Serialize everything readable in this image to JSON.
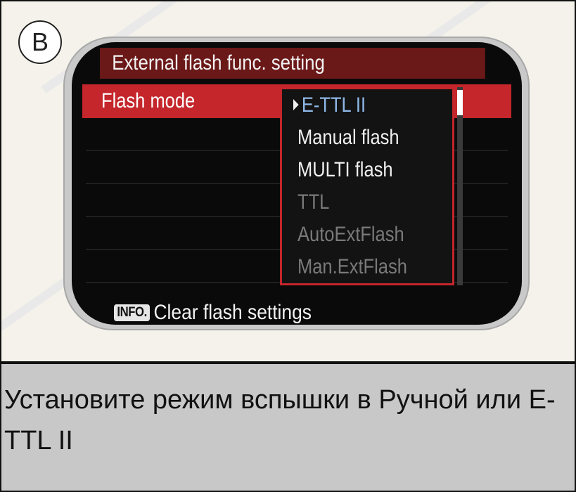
{
  "panel_label": "B",
  "menu": {
    "title": "External flash func. setting",
    "row_label": "Flash mode",
    "options": [
      {
        "label": "E-TTL II",
        "state": "selected"
      },
      {
        "label": "Manual flash",
        "state": "bright"
      },
      {
        "label": "MULTI  flash",
        "state": "bright"
      },
      {
        "label": "TTL",
        "state": "dim"
      },
      {
        "label": "AutoExtFlash",
        "state": "dim"
      },
      {
        "label": "Man.ExtFlash",
        "state": "dim"
      }
    ],
    "scroll_fraction": 0.13
  },
  "footer": {
    "info_badge": "INFO.",
    "info_text": "Clear flash settings"
  },
  "caption": "Установите режим вспышки в Ручной или E-TTL II",
  "colors": {
    "accent": "#c4262b",
    "selected_text": "#8fb8e8",
    "dim_text": "#7a7a7a"
  }
}
